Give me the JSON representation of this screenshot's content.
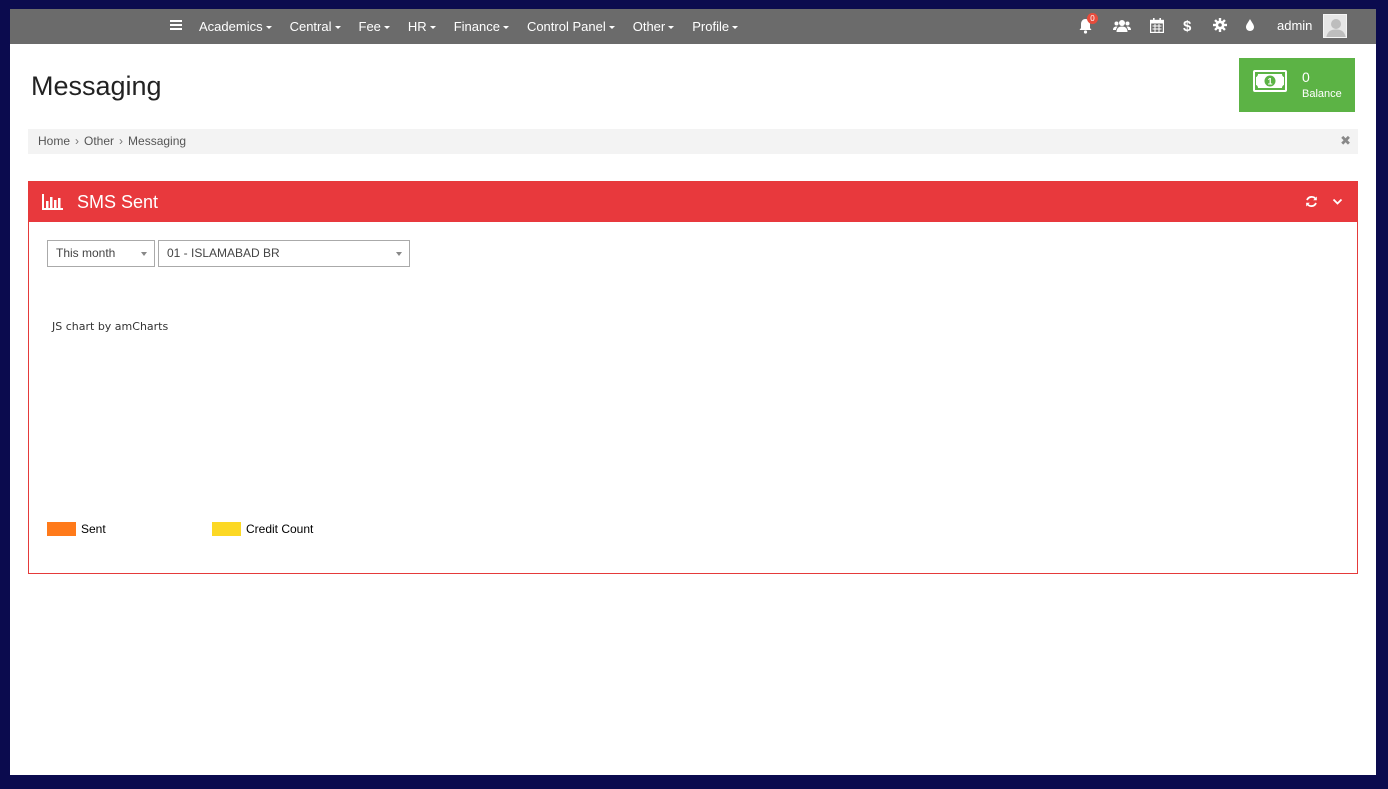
{
  "navbar": {
    "menu_icon": "hamburger-icon",
    "items": [
      {
        "label": "Academics"
      },
      {
        "label": "Central"
      },
      {
        "label": "Fee"
      },
      {
        "label": "HR"
      },
      {
        "label": "Finance"
      },
      {
        "label": "Control Panel"
      },
      {
        "label": "Other"
      },
      {
        "label": "Profile"
      }
    ],
    "icons": [
      "bell-icon",
      "users-icon",
      "calendar-icon",
      "dollar-icon",
      "gear-icon",
      "droplet-icon"
    ],
    "notification_count": "0",
    "user_name": "admin"
  },
  "page": {
    "title": "Messaging"
  },
  "balance": {
    "value": "0",
    "label": "Balance",
    "color": "#5cb345"
  },
  "breadcrumb": {
    "items": [
      "Home",
      "Other",
      "Messaging"
    ],
    "close_icon": "close-icon"
  },
  "panel": {
    "title": "SMS Sent",
    "color": "#e8393d",
    "icons": [
      "bar-chart-icon",
      "refresh-icon",
      "chevron-down-icon"
    ]
  },
  "filters": {
    "period": "This month",
    "branch": "01 - ISLAMABAD BR"
  },
  "chart": {
    "credit": "JS chart by amCharts",
    "legend": [
      {
        "label": "Sent",
        "color": "#ff7a1a"
      },
      {
        "label": "Credit Count",
        "color": "#fcd824"
      }
    ]
  }
}
